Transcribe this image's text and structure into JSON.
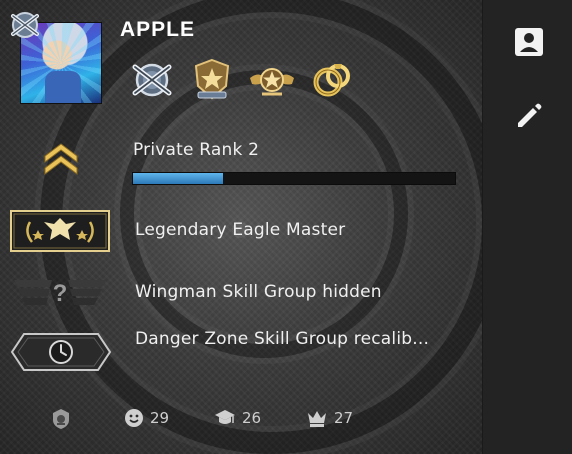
{
  "player": {
    "name": "APPLE"
  },
  "medals": [
    {
      "icon": "crossed-guns-medal-icon"
    },
    {
      "icon": "star-shield-medal-icon"
    },
    {
      "icon": "winged-star-medal-icon"
    },
    {
      "icon": "gold-rings-medal-icon"
    }
  ],
  "profile_rank": {
    "label": "Private Rank 2",
    "progress_fraction": 0.28
  },
  "competitive": {
    "label": "Legendary Eagle Master"
  },
  "wingman": {
    "label": "Wingman Skill Group hidden"
  },
  "danger_zone": {
    "label": "Danger Zone Skill Group recalib..."
  },
  "stats": {
    "friendly": "29",
    "teacher": "26",
    "leader": "27"
  },
  "colors": {
    "progress_fill": "#3d8fd0",
    "gold": "#d9b255"
  }
}
